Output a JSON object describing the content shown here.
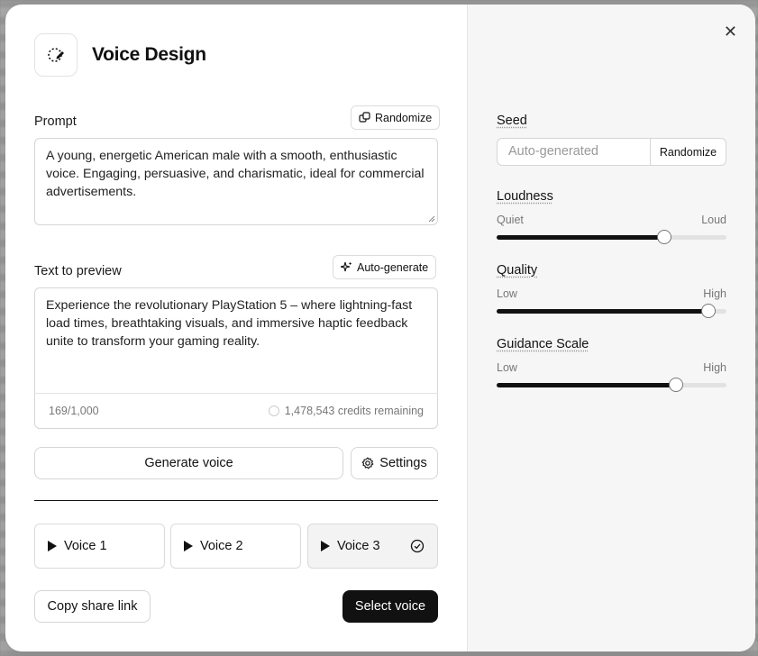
{
  "dialog": {
    "title": "Voice Design",
    "close_label": "✕"
  },
  "prompt": {
    "label": "Prompt",
    "randomize_label": "Randomize",
    "value": "A young, energetic American male with a smooth, enthusiastic voice. Engaging, persuasive, and charismatic, ideal for commercial advertisements."
  },
  "preview": {
    "label": "Text to preview",
    "autogen_label": "Auto-generate",
    "value": "Experience the revolutionary PlayStation 5 – where lightning-fast load times, breathtaking visuals, and immersive haptic feedback unite to transform your gaming reality.",
    "char_count": "169/1,000",
    "credits": "1,478,543 credits remaining"
  },
  "actions": {
    "generate_label": "Generate voice",
    "settings_label": "Settings",
    "copy_link_label": "Copy share link",
    "select_label": "Select voice"
  },
  "voices": [
    {
      "label": "Voice 1",
      "selected": false
    },
    {
      "label": "Voice 2",
      "selected": false
    },
    {
      "label": "Voice 3",
      "selected": true
    }
  ],
  "settings": {
    "seed": {
      "label": "Seed",
      "placeholder": "Auto-generated",
      "randomize_label": "Randomize"
    },
    "loudness": {
      "label": "Loudness",
      "min": "Quiet",
      "max": "Loud",
      "value": 0.73
    },
    "quality": {
      "label": "Quality",
      "min": "Low",
      "max": "High",
      "value": 0.92
    },
    "guidance": {
      "label": "Guidance Scale",
      "min": "Low",
      "max": "High",
      "value": 0.78
    }
  },
  "colors": {
    "primary": "#111111",
    "panel": "#f6f6f6"
  }
}
